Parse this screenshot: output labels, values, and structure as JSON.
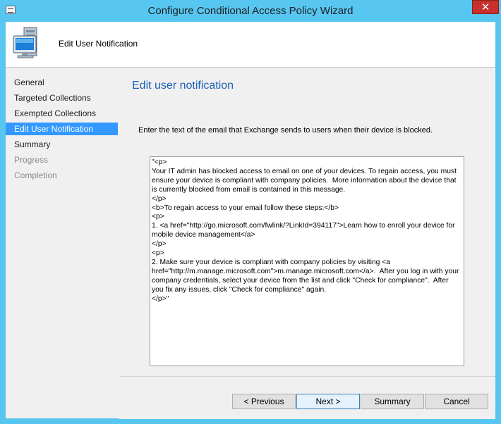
{
  "window": {
    "title": "Configure Conditional Access Policy Wizard",
    "close_symbol": "✕"
  },
  "header": {
    "title": "Edit User Notification",
    "icon": "computer-icon"
  },
  "sidebar": {
    "items": [
      {
        "label": "General",
        "state": "normal"
      },
      {
        "label": "Targeted Collections",
        "state": "normal"
      },
      {
        "label": "Exempted Collections",
        "state": "normal"
      },
      {
        "label": "Edit User Notification",
        "state": "active"
      },
      {
        "label": "Summary",
        "state": "normal"
      },
      {
        "label": "Progress",
        "state": "disabled"
      },
      {
        "label": "Completion",
        "state": "disabled"
      }
    ]
  },
  "main": {
    "title": "Edit user notification",
    "instruction": "Enter the text of the email that Exchange sends to users when their device is blocked.",
    "email_text": "\"<p>\nYour IT admin has blocked access to email on one of your devices. To regain access, you must ensure your device is compliant with company policies.  More information about the device that is currently blocked from email is contained in this message.\n</p>\n<b>To regain access to your email follow these steps:</b>\n<p>\n1. <a href=\"http://go.microsoft.com/fwlink/?LinkId=394117\">Learn how to enroll your device for mobile device management</a>\n</p>\n<p>\n2. Make sure your device is compliant with company policies by visiting <a href=\"http://m.manage.microsoft.com\">m.manage.microsoft.com</a>.  After you log in with your company credentials, select your device from the list and click \"Check for compliance\".  After you fix any issues, click \"Check for compliance\" again.\n</p>\""
  },
  "footer": {
    "previous_label": "< Previous",
    "next_label": "Next >",
    "summary_label": "Summary",
    "cancel_label": "Cancel"
  },
  "colors": {
    "window_frame": "#57c6f0",
    "selection": "#3399ff",
    "title_blue": "#1a5fb4",
    "close_red": "#c7302b"
  }
}
